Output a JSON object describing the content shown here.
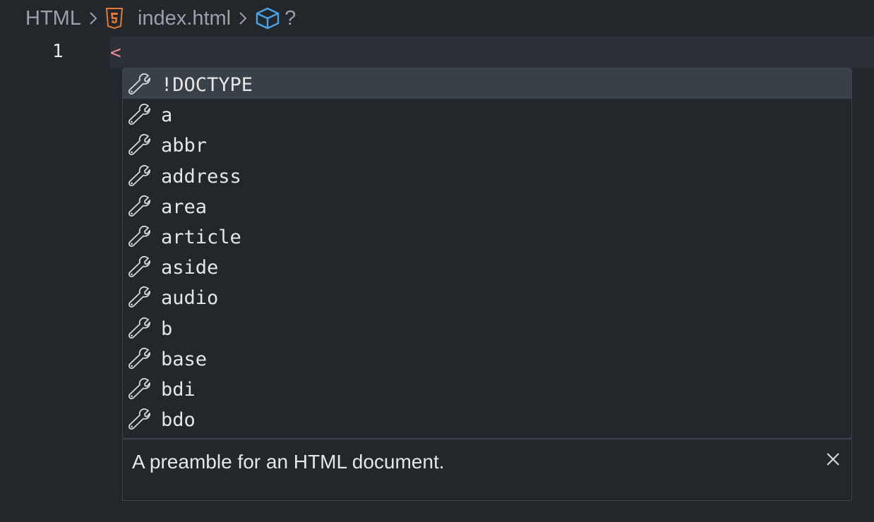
{
  "breadcrumb": {
    "segments": [
      "HTML",
      "index.html",
      "?"
    ],
    "icons": [
      "html5-icon",
      "cube-icon"
    ]
  },
  "editor": {
    "line_number": "1",
    "line_text": "<"
  },
  "suggest": {
    "selected_index": 0,
    "item_icon": "wrench-icon",
    "items": [
      "!DOCTYPE",
      "a",
      "abbr",
      "address",
      "area",
      "article",
      "aside",
      "audio",
      "b",
      "base",
      "bdi",
      "bdo"
    ]
  },
  "details": {
    "text": "A preamble for an HTML document.",
    "close_icon": "close-icon"
  },
  "colors": {
    "background": "#22272b",
    "selected_item": "#384048",
    "html5_orange": "#e37933",
    "cube_blue": "#4aa3e8",
    "tag_pink": "#f08c9a"
  }
}
